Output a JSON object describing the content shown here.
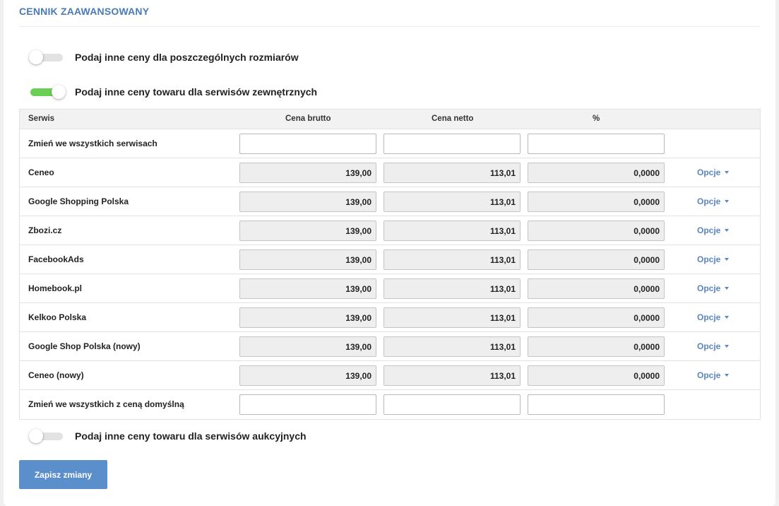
{
  "section": {
    "title": "CENNIK ZAAWANSOWANY"
  },
  "toggles": [
    {
      "label": "Podaj inne ceny dla poszczególnych rozmiarów",
      "on": false
    },
    {
      "label": "Podaj inne ceny towaru dla serwisów zewnętrznych",
      "on": true
    },
    {
      "label": "Podaj inne ceny towaru dla serwisów aukcyjnych",
      "on": false
    }
  ],
  "colors": {
    "accent": "#4a7ab6",
    "toggle_on": "#6ccf55",
    "button": "#5b8fcb",
    "link": "#5a86c0"
  },
  "icons": {
    "options_caret": "caret-down-icon"
  },
  "table": {
    "headers": {
      "service": "Serwis",
      "gross": "Cena brutto",
      "net": "Cena netto",
      "percent": "%"
    },
    "change_all_label": "Zmień we wszystkich serwisach",
    "change_all_default_label": "Zmień we wszystkich z ceną domyślną",
    "options_label": "Opcje",
    "rows": [
      {
        "service": "Ceneo",
        "gross": "139,00",
        "net": "113,01",
        "percent": "0,0000"
      },
      {
        "service": "Google Shopping Polska",
        "gross": "139,00",
        "net": "113,01",
        "percent": "0,0000"
      },
      {
        "service": "Zbozi.cz",
        "gross": "139,00",
        "net": "113,01",
        "percent": "0,0000"
      },
      {
        "service": "FacebookAds",
        "gross": "139,00",
        "net": "113,01",
        "percent": "0,0000"
      },
      {
        "service": "Homebook.pl",
        "gross": "139,00",
        "net": "113,01",
        "percent": "0,0000"
      },
      {
        "service": "Kelkoo Polska",
        "gross": "139,00",
        "net": "113,01",
        "percent": "0,0000"
      },
      {
        "service": "Google Shop Polska (nowy)",
        "gross": "139,00",
        "net": "113,01",
        "percent": "0,0000"
      },
      {
        "service": "Ceneo (nowy)",
        "gross": "139,00",
        "net": "113,01",
        "percent": "0,0000"
      }
    ]
  },
  "save_button": {
    "label": "Zapisz zmiany"
  }
}
